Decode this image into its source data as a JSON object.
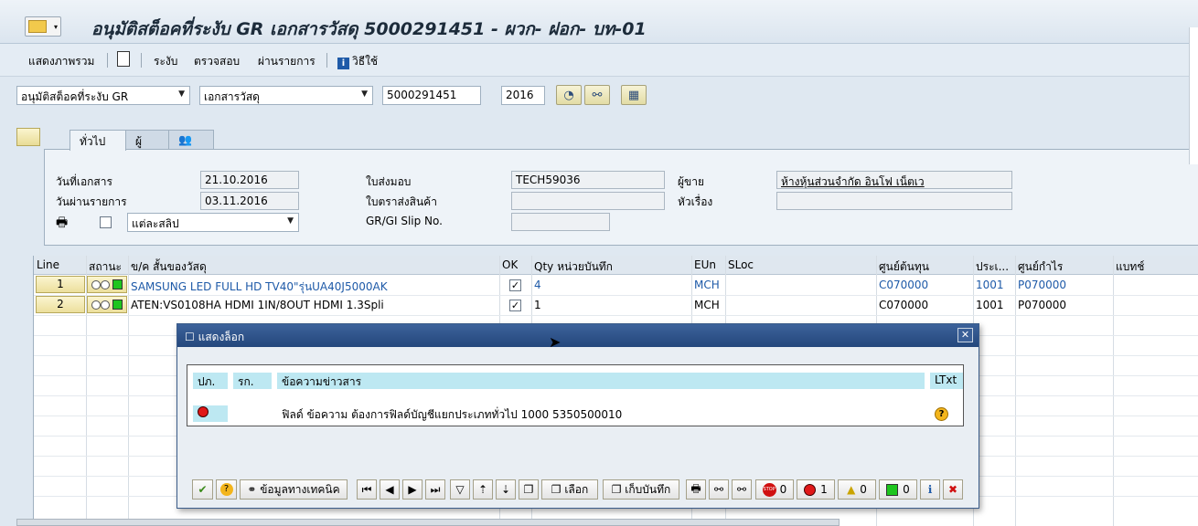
{
  "window": {
    "title": "อนุมัติสต็อคที่ระงับ GR เอกสารวัสดุ 5000291451 - ผวก- ฝอก- บท-01"
  },
  "app_toolbar": {
    "overview": "แสดงภาพรวม",
    "hold": "ระงับ",
    "check": "ตรวจสอบ",
    "post": "ผ่านรายการ",
    "help": "วิธีใช้"
  },
  "selection": {
    "action": "อนุมัติสต็อคที่ระงับ GR",
    "reference": "เอกสารวัสดุ",
    "doc_number": "5000291451",
    "year": "2016"
  },
  "tabs": [
    "ทั่วไป",
    "ผู้ขาย"
  ],
  "header": {
    "doc_date_label": "วันที่เอกสาร",
    "doc_date": "21.10.2016",
    "post_date_label": "วันผ่านรายการ",
    "post_date": "03.11.2016",
    "print_option": "แต่ละสลิป",
    "delivery_note_label": "ใบส่งมอบ",
    "delivery_note": "TECH59036",
    "bill_of_lading_label": "ใบตราส่งสินค้า",
    "bill_of_lading": "",
    "slip_label": "GR/GI Slip No.",
    "slip": "",
    "vendor_label": "ผู้ขาย",
    "vendor": "ห้างหุ้นส่วนจำกัด อินโฟ เน็ตเว",
    "header_text_label": "หัวเรื่อง",
    "header_text": ""
  },
  "grid": {
    "columns": [
      "Line",
      "สถานะ",
      "ข/ค สั้นของวัสดุ",
      "OK",
      "Qty หน่วยบันทึก",
      "EUn",
      "SLoc",
      "ศูนย์ต้นทุน",
      "ประเ...",
      "ศูนย์กำไร",
      "แบทช์"
    ],
    "rows": [
      {
        "line": "1",
        "material": "SAMSUNG LED FULL HD TV40\"รุ่นUA40J5000AK",
        "ok": true,
        "qty": "4",
        "eun": "MCH",
        "sloc": "",
        "cost_center": "C070000",
        "type": "1001",
        "profit_center": "P070000",
        "batch": "",
        "blue": true
      },
      {
        "line": "2",
        "material": "ATEN:VS0108HA HDMI 1IN/8OUT HDMI 1.3Spli",
        "ok": true,
        "qty": "1",
        "eun": "MCH",
        "sloc": "",
        "cost_center": "C070000",
        "type": "1001",
        "profit_center": "P070000",
        "batch": "",
        "blue": false
      }
    ]
  },
  "dialog": {
    "title": "แสดงล็อก",
    "col_type": "ปภ.",
    "col_no": "รก.",
    "col_message": "ข้อความข่าวสาร",
    "col_ltxt": "LTxt",
    "message": "ฟิลด์ ข้อความ ต้องการฟิลด์บัญชีแยกประเภททั่วไป 1000 5350500010",
    "btn_tech_info": "ข้อมูลทางเทคนิค",
    "btn_choose": "เลือก",
    "btn_save": "เก็บบันทึก",
    "count_stop": "0",
    "count_error": "1",
    "count_warning": "0",
    "count_info": "0"
  },
  "colors": {
    "accent": "#1e5aa8",
    "dialog_header": "#24477c",
    "message_header": "#bde8f2"
  }
}
